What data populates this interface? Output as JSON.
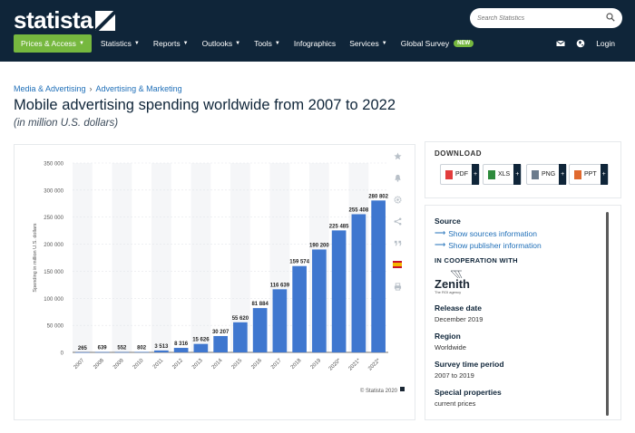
{
  "header": {
    "logo_text": "statista",
    "search_placeholder": "Search Statistics",
    "nav": [
      {
        "label": "Prices & Access"
      },
      {
        "label": "Statistics"
      },
      {
        "label": "Reports"
      },
      {
        "label": "Outlooks"
      },
      {
        "label": "Tools"
      },
      {
        "label": "Infographics"
      },
      {
        "label": "Services"
      },
      {
        "label": "Global Survey"
      }
    ],
    "new_badge": "NEW",
    "login_label": "Login"
  },
  "breadcrumb": {
    "items": [
      "Media & Advertising",
      "Advertising & Marketing"
    ],
    "separator": "›"
  },
  "page": {
    "title": "Mobile advertising spending worldwide from 2007 to 2022",
    "subtitle": "(in million U.S. dollars)"
  },
  "chart_data": {
    "type": "bar",
    "categories": [
      "2007",
      "2008",
      "2009",
      "2010",
      "2011",
      "2012",
      "2013",
      "2014",
      "2015",
      "2016",
      "2017",
      "2018",
      "2019",
      "2020*",
      "2021*",
      "2022*"
    ],
    "values": [
      265,
      639,
      552,
      802,
      3513,
      8316,
      15626,
      30207,
      55620,
      81884,
      116639,
      159574,
      190200,
      225485,
      255408,
      280802
    ],
    "value_labels": [
      "265",
      "639",
      "552",
      "802",
      "3 513",
      "8 316",
      "15 626",
      "30 207",
      "55 620",
      "81 884",
      "116 639",
      "159 574",
      "190 200",
      "225 485",
      "255 408",
      "280 802"
    ],
    "ylabel": "Spending in million U.S. dollars",
    "yticks": [
      "0",
      "50 000",
      "100 000",
      "150 000",
      "200 000",
      "250 000",
      "300 000",
      "350 000"
    ],
    "ylim": [
      0,
      350000
    ],
    "bar_color": "#3f77cf",
    "grid": true,
    "credit": "© Statista 2020"
  },
  "download": {
    "title": "DOWNLOAD",
    "buttons": [
      "PDF",
      "XLS",
      "PNG",
      "PPT"
    ],
    "plus": "+"
  },
  "info": {
    "source_label": "Source",
    "show_sources": "Show sources information",
    "show_publisher": "Show publisher information",
    "cooperation_label": "IN COOPERATION WITH",
    "partner_name": "Zenith",
    "partner_tagline": "The ROI agency",
    "release_label": "Release date",
    "release_value": "December 2019",
    "region_label": "Region",
    "region_value": "Worldwide",
    "survey_label": "Survey time period",
    "survey_value": "2007 to 2019",
    "special_label": "Special properties",
    "special_value": "current prices"
  },
  "colors": {
    "header_bg": "#0f2539",
    "accent_green": "#76b83f",
    "link_blue": "#1f6fb8"
  }
}
